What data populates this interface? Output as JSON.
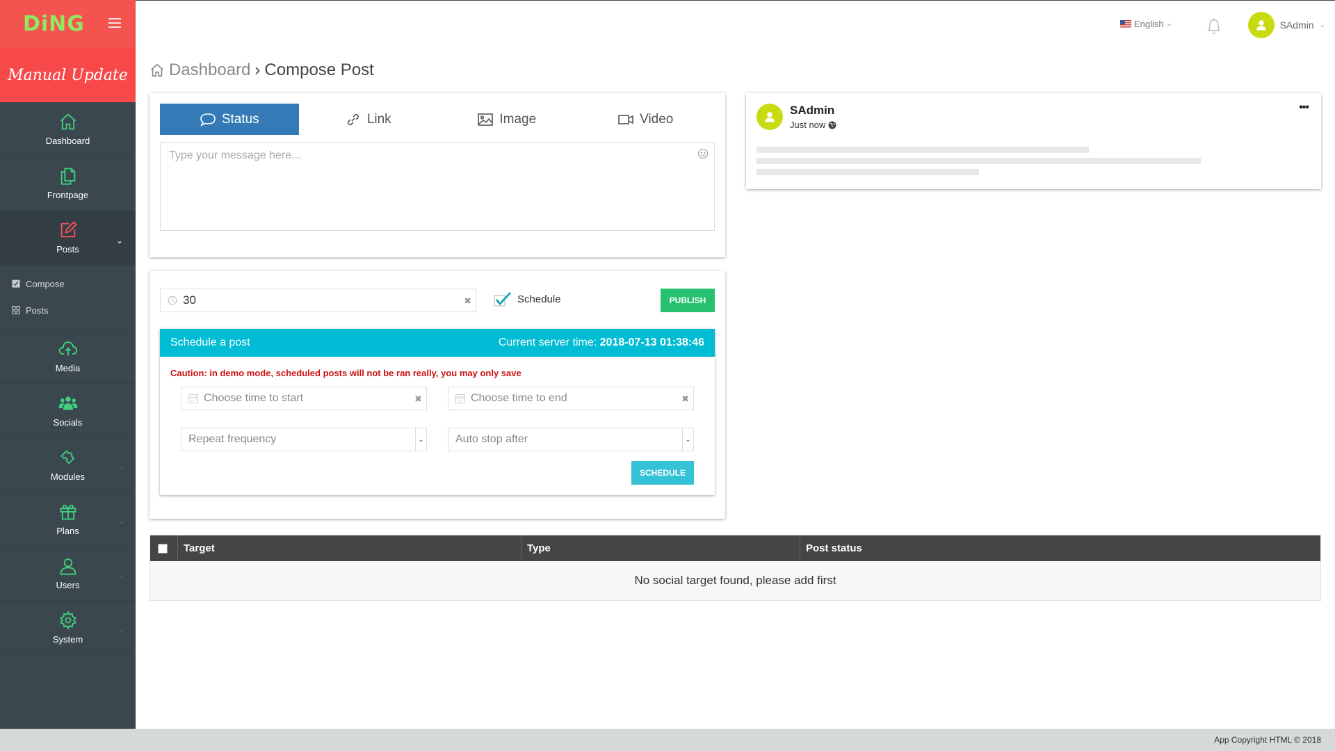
{
  "brand": {
    "logo": "DiNG",
    "subtitle": "Manual Update"
  },
  "topbar": {
    "language": "English",
    "user_name": "SAdmin"
  },
  "sidebar": {
    "items": [
      {
        "label": "Dashboard",
        "icon": "home-icon"
      },
      {
        "label": "Frontpage",
        "icon": "pages-icon"
      },
      {
        "label": "Posts",
        "icon": "edit-icon"
      },
      {
        "label": "Media",
        "icon": "cloud-upload-icon"
      },
      {
        "label": "Socials",
        "icon": "users-group-icon"
      },
      {
        "label": "Modules",
        "icon": "puzzle-icon"
      },
      {
        "label": "Plans",
        "icon": "gift-icon"
      },
      {
        "label": "Users",
        "icon": "user-icon"
      },
      {
        "label": "System",
        "icon": "gear-icon"
      }
    ],
    "subnav": [
      {
        "label": "Compose"
      },
      {
        "label": "Posts"
      }
    ]
  },
  "breadcrumb": {
    "parent": "Dashboard",
    "current": "Compose Post"
  },
  "compose": {
    "tabs": [
      {
        "label": "Status"
      },
      {
        "label": "Link"
      },
      {
        "label": "Image"
      },
      {
        "label": "Video"
      }
    ],
    "message_placeholder": "Type your message here..."
  },
  "publish": {
    "interval_value": "30",
    "schedule_label": "Schedule",
    "publish_label": "PUBLISH"
  },
  "schedule_panel": {
    "title": "Schedule a post",
    "server_time_label": "Current server time:",
    "server_time": "2018-07-13 01:38:46",
    "caution": "Caution: in demo mode, scheduled posts will not be ran really, you may only save",
    "start_placeholder": "Choose time to start",
    "end_placeholder": "Choose time to end",
    "repeat_label": "Repeat frequency",
    "autostop_label": "Auto stop after",
    "schedule_button": "SCHEDULE"
  },
  "preview": {
    "name": "SAdmin",
    "time": "Just now"
  },
  "table": {
    "columns": [
      "Target",
      "Type",
      "Post status"
    ],
    "empty_message": "No social target found, please add first"
  },
  "footer": {
    "copyright": "App Copyright HTML © 2018"
  },
  "colors": {
    "brand_red": "#f55350",
    "sidebar": "#3b474f",
    "accent_blue": "#337ab7",
    "cyan": "#00bcd4",
    "green": "#25c171",
    "icon_green": "#3fd07d",
    "avatar": "#c8da10"
  }
}
